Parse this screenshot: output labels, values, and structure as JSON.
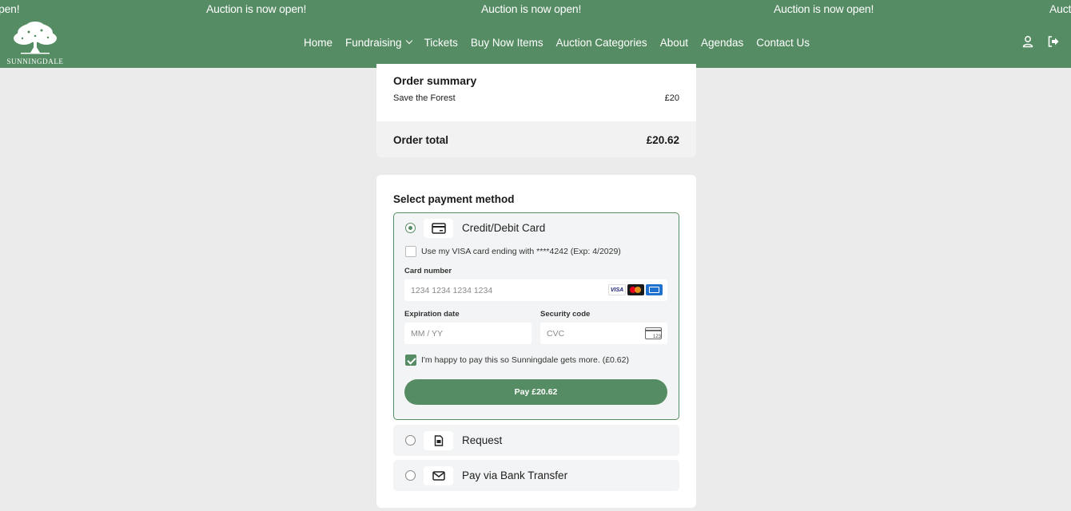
{
  "ticker": {
    "messages": [
      "pen!",
      "Auction is now open!",
      "Auction is now open!",
      "Auction is now open!",
      "Aucti"
    ]
  },
  "brand": {
    "name": "SUNNINGDALE",
    "color": "#558c63"
  },
  "nav": {
    "items": [
      "Home",
      "Fundraising",
      "Tickets",
      "Buy Now Items",
      "Auction Categories",
      "About",
      "Agendas",
      "Contact Us"
    ],
    "icons": [
      "user-icon",
      "logout-icon"
    ]
  },
  "order_summary": {
    "title": "Order summary",
    "item_name": "Save the Forest",
    "item_price": "£20",
    "total_label": "Order total",
    "total_value": "£20.62"
  },
  "payment": {
    "title": "Select payment method",
    "methods": [
      {
        "label": "Credit/Debit Card",
        "icon": "credit-card-icon",
        "selected": true
      },
      {
        "label": "Request",
        "icon": "document-icon",
        "selected": false
      },
      {
        "label": "Pay via Bank Transfer",
        "icon": "envelope-icon",
        "selected": false
      }
    ],
    "saved_card_label": "Use my VISA card ending with ****4242 (Exp: 4/2029)",
    "card_number_label": "Card number",
    "card_number_placeholder": "1234 1234 1234 1234",
    "card_brands": [
      "VISA",
      "Mastercard",
      "Amex"
    ],
    "expiration_label": "Expiration date",
    "expiration_placeholder": "MM / YY",
    "security_label": "Security code",
    "security_placeholder": "CVC",
    "cvc_hint": "123",
    "fee_label": "I'm happy to pay this so Sunningdale gets more. (£0.62)",
    "fee_checked": true,
    "pay_button": "Pay £20.62"
  }
}
